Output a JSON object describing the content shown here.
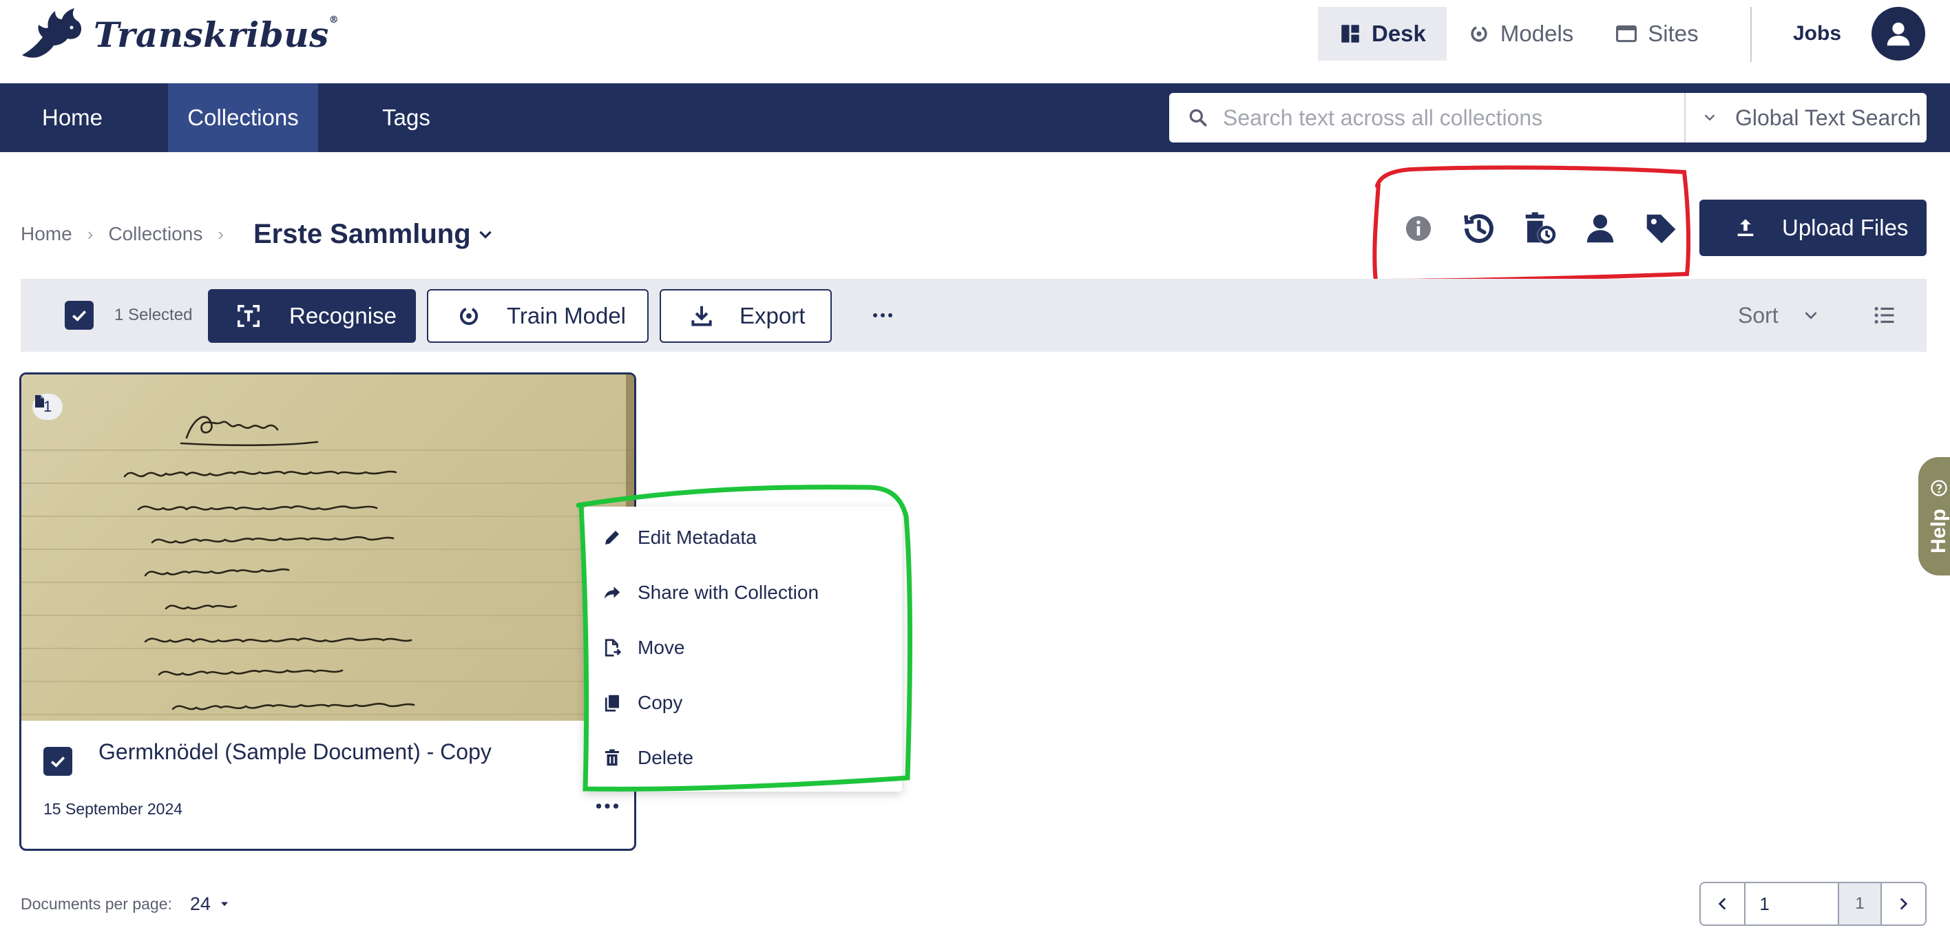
{
  "app": {
    "name": "Transkribus",
    "trademark": "®"
  },
  "topnav": {
    "items": [
      {
        "label": "Desk",
        "icon": "dashboard-icon",
        "active": true
      },
      {
        "label": "Models",
        "icon": "models-icon",
        "active": false
      },
      {
        "label": "Sites",
        "icon": "window-icon",
        "active": false
      }
    ],
    "jobs_label": "Jobs",
    "avatar_icon": "user-avatar-icon"
  },
  "navbar": {
    "tabs": [
      {
        "label": "Home",
        "active": false
      },
      {
        "label": "Collections",
        "active": true
      },
      {
        "label": "Tags",
        "active": false
      }
    ],
    "search": {
      "placeholder": "Search text across all collections",
      "value": "",
      "scope": "Global Text Search"
    }
  },
  "breadcrumb": {
    "items": [
      "Home",
      "Collections"
    ],
    "current": "Erste Sammlung"
  },
  "collection_tools": {
    "icons": [
      "info-icon",
      "history-icon",
      "scheduled-delete-icon",
      "user-icon",
      "tag-icon"
    ]
  },
  "upload": {
    "label": "Upload Files"
  },
  "toolbar": {
    "selected_text": "1 Selected",
    "recognise_label": "Recognise",
    "train_label": "Train Model",
    "export_label": "Export",
    "sort_label": "Sort"
  },
  "document": {
    "pages": "1",
    "title": "Germknödel (Sample Document) - Copy",
    "date": "15 September 2024",
    "checked": true
  },
  "context_menu": {
    "items": [
      {
        "label": "Edit Metadata",
        "icon": "pencil-icon"
      },
      {
        "label": "Share with Collection",
        "icon": "share-icon"
      },
      {
        "label": "Move",
        "icon": "move-file-icon"
      },
      {
        "label": "Copy",
        "icon": "copy-icon"
      },
      {
        "label": "Delete",
        "icon": "trash-icon"
      }
    ]
  },
  "help": {
    "label": "Help"
  },
  "pagination": {
    "per_page_label": "Documents per page:",
    "per_page_value": "24",
    "current_page": "1",
    "total_pages": "1"
  },
  "colors": {
    "brand_navy": "#212f5c",
    "nav_active": "#344b8a",
    "toolbar_bg": "#e8eaf0",
    "annotation_red": "#e0202a",
    "annotation_green": "#1ec43a",
    "help_tab": "#8a8a63"
  }
}
